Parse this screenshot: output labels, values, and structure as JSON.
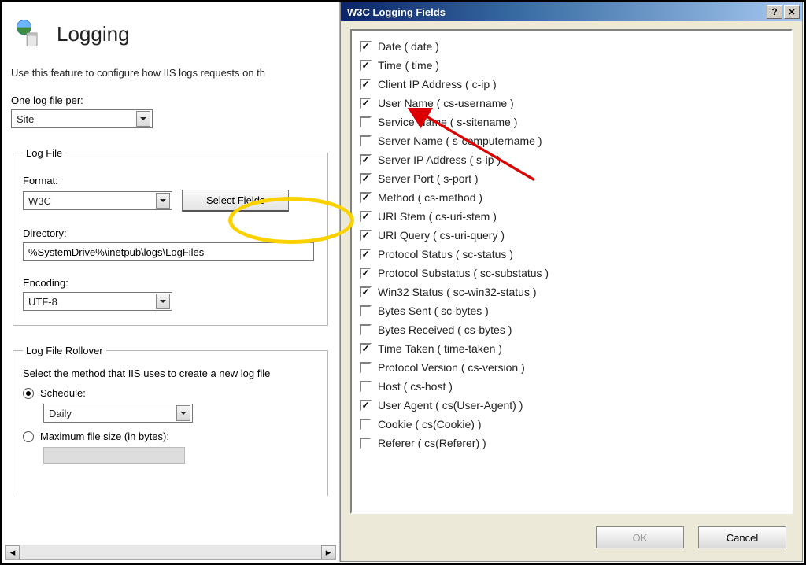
{
  "page": {
    "title": "Logging",
    "intro": "Use this feature to configure how IIS logs requests on th"
  },
  "one_log": {
    "label": "One log file per:",
    "value": "Site"
  },
  "log_file": {
    "legend": "Log File",
    "format_label": "Format:",
    "format_value": "W3C",
    "select_fields_label": "Select Fields",
    "directory_label": "Directory:",
    "directory_value": "%SystemDrive%\\inetpub\\logs\\LogFiles",
    "encoding_label": "Encoding:",
    "encoding_value": "UTF-8"
  },
  "rollover": {
    "legend": "Log File Rollover",
    "desc": "Select the method that IIS uses to create a new log file",
    "schedule_label": "Schedule:",
    "schedule_value": "Daily",
    "max_label": "Maximum file size (in bytes):"
  },
  "dialog": {
    "title": "W3C Logging Fields",
    "ok_label": "OK",
    "cancel_label": "Cancel",
    "fields": [
      {
        "label": "Date ( date )",
        "checked": true
      },
      {
        "label": "Time ( time )",
        "checked": true
      },
      {
        "label": "Client IP Address ( c-ip )",
        "checked": true
      },
      {
        "label": "User Name ( cs-username )",
        "checked": true
      },
      {
        "label": "Service Name ( s-sitename )",
        "checked": false
      },
      {
        "label": "Server Name ( s-computername )",
        "checked": false
      },
      {
        "label": "Server IP Address ( s-ip )",
        "checked": true
      },
      {
        "label": "Server Port ( s-port )",
        "checked": true
      },
      {
        "label": "Method ( cs-method )",
        "checked": true
      },
      {
        "label": "URI Stem ( cs-uri-stem )",
        "checked": true
      },
      {
        "label": "URI Query ( cs-uri-query )",
        "checked": true
      },
      {
        "label": "Protocol Status ( sc-status )",
        "checked": true
      },
      {
        "label": "Protocol Substatus ( sc-substatus )",
        "checked": true
      },
      {
        "label": "Win32 Status ( sc-win32-status )",
        "checked": true
      },
      {
        "label": "Bytes Sent ( sc-bytes )",
        "checked": false
      },
      {
        "label": "Bytes Received ( cs-bytes )",
        "checked": false
      },
      {
        "label": "Time Taken ( time-taken )",
        "checked": true
      },
      {
        "label": "Protocol Version ( cs-version )",
        "checked": false
      },
      {
        "label": "Host ( cs-host )",
        "checked": false
      },
      {
        "label": "User Agent ( cs(User-Agent) )",
        "checked": true
      },
      {
        "label": "Cookie ( cs(Cookie) )",
        "checked": false
      },
      {
        "label": "Referer ( cs(Referer) )",
        "checked": false
      }
    ]
  }
}
